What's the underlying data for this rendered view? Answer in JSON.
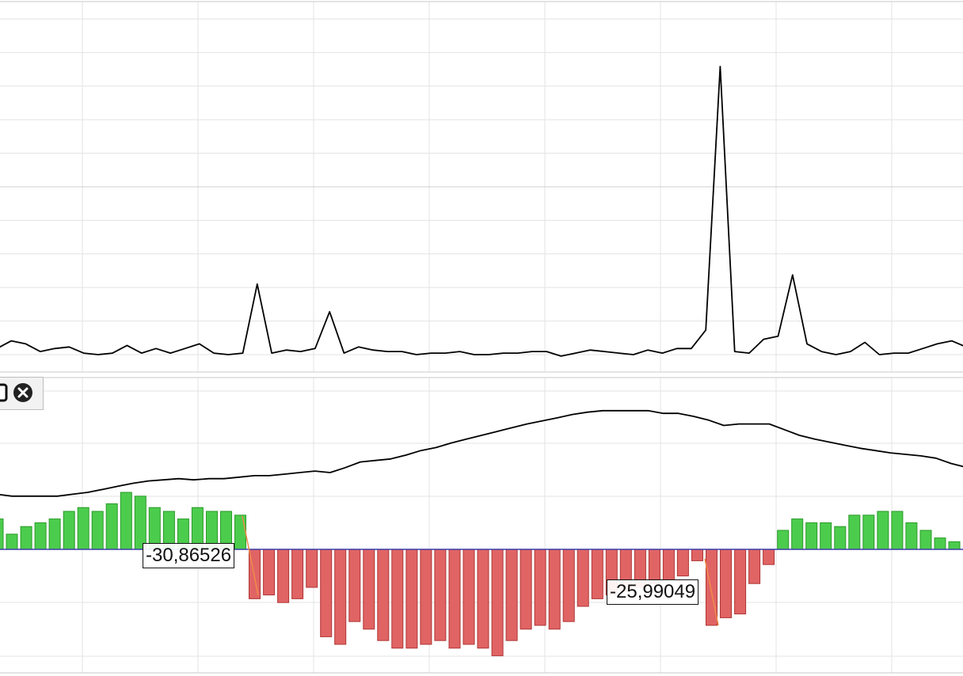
{
  "toolbar": {
    "icons": [
      "window-icon",
      "close-icon"
    ]
  },
  "chart_data": [
    {
      "type": "line",
      "panel": "upper",
      "grid": true,
      "ylim": [
        0,
        11
      ],
      "series": [
        {
          "values": [
            0.2,
            0.45,
            0.35,
            0.1,
            0.2,
            0.25,
            0.05,
            0.0,
            0.05,
            0.3,
            0.05,
            0.2,
            0.05,
            0.2,
            0.35,
            0.05,
            0.0,
            0.05,
            2.3,
            0.05,
            0.15,
            0.1,
            0.2,
            1.4,
            0.05,
            0.25,
            0.15,
            0.1,
            0.1,
            0.0,
            0.05,
            0.05,
            0.1,
            0.0,
            0.0,
            0.05,
            0.05,
            0.1,
            0.1,
            -0.05,
            0.05,
            0.15,
            0.1,
            0.05,
            0.0,
            0.15,
            0.05,
            0.2,
            0.2,
            0.8,
            9.4,
            0.1,
            0.05,
            0.5,
            0.6,
            2.6,
            0.35,
            0.1,
            0.0,
            0.1,
            0.4,
            0.0,
            0.05,
            0.05,
            0.2,
            0.35,
            0.45,
            0.25
          ]
        }
      ]
    },
    {
      "type": "bar",
      "panel": "lower",
      "grid": true,
      "ylim": [
        -40,
        30
      ],
      "line_series": {
        "values": [
          14.5,
          14,
          14,
          14,
          14,
          14.5,
          15,
          15.8,
          16.6,
          17.4,
          18,
          18.3,
          18.6,
          18.3,
          18.6,
          18.6,
          19,
          19.4,
          19.4,
          19.8,
          20.2,
          20.6,
          20.2,
          21.5,
          23,
          23.4,
          23.8,
          24.8,
          26,
          26.8,
          28,
          29,
          30,
          31,
          32,
          33,
          33.8,
          34.6,
          35.5,
          36.1,
          36.5,
          36.5,
          36.5,
          36.5,
          35.8,
          35.8,
          35,
          34,
          32.6,
          33,
          33,
          33,
          31.5,
          30,
          29,
          28.2,
          27.4,
          26.6,
          26,
          25.4,
          25,
          24.6,
          24,
          22.6,
          21.6
        ]
      },
      "values": [
        8,
        4,
        6,
        7,
        8,
        10,
        11,
        10,
        12,
        15,
        14,
        11,
        10,
        8,
        11,
        10,
        10,
        9,
        -13,
        -12,
        -14,
        -13,
        -10,
        -23,
        -25,
        -19,
        -21,
        -24,
        -26,
        -26,
        -25,
        -24,
        -26,
        -25,
        -26,
        -28,
        -24,
        -21,
        -20,
        -21,
        -19,
        -15,
        -13,
        -12,
        -11,
        -10,
        -9,
        -8,
        -7,
        -3,
        -20,
        -18,
        -17,
        -9,
        -4,
        5,
        8,
        7,
        7,
        6,
        9,
        9,
        10,
        10,
        7,
        5,
        3,
        2
      ],
      "annotations": [
        "-30,86526",
        "-25,99049"
      ]
    }
  ]
}
